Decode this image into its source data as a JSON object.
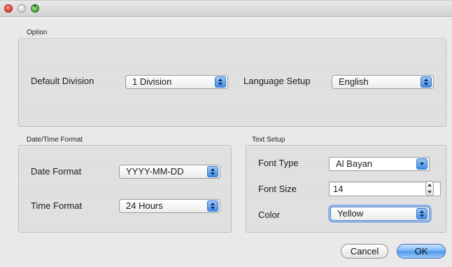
{
  "option": {
    "group_label": "Option",
    "default_division": {
      "label": "Default Division",
      "value": "1 Division"
    },
    "language_setup": {
      "label": "Language Setup",
      "value": "English"
    }
  },
  "datetime": {
    "group_label": "Date/Time Format",
    "date_format": {
      "label": "Date Format",
      "value": "YYYY-MM-DD"
    },
    "time_format": {
      "label": "Time Format",
      "value": "24 Hours"
    }
  },
  "text_setup": {
    "group_label": "Text Setup",
    "font_type": {
      "label": "Font Type",
      "value": "Al Bayan"
    },
    "font_size": {
      "label": "Font Size",
      "value": "14"
    },
    "color": {
      "label": "Color",
      "value": "Yellow"
    }
  },
  "buttons": {
    "cancel": "Cancel",
    "ok": "OK"
  }
}
